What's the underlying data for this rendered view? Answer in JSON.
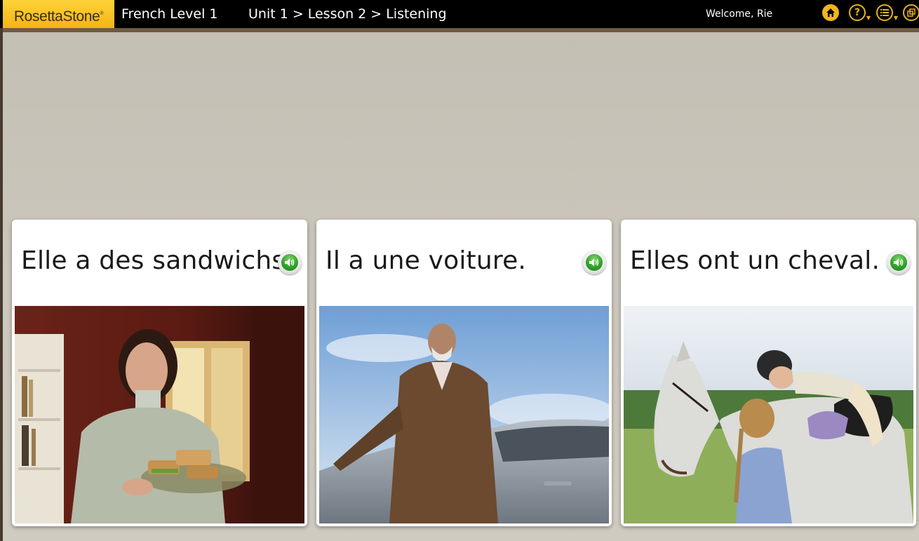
{
  "header": {
    "logo": "RosettaStone",
    "course_title": "French Level 1",
    "breadcrumb": [
      "Unit 1",
      "Lesson 2",
      "Listening"
    ],
    "breadcrumb_separator": ">",
    "welcome": "Welcome, Rie",
    "nav_icons": [
      "home-icon",
      "help-icon",
      "menu-list-icon",
      "window-icon"
    ]
  },
  "cards": [
    {
      "text": "Elle a des sandwichs.",
      "image": "woman-holding-sandwiches",
      "audio_icon": "speaker-icon"
    },
    {
      "text": "Il a une voiture.",
      "image": "man-standing-by-car",
      "audio_icon": "speaker-icon"
    },
    {
      "text": "Elles ont un cheval.",
      "image": "girls-with-horse",
      "audio_icon": "speaker-icon"
    }
  ],
  "colors": {
    "logo_bg": "#f3b416",
    "topbar_bg": "#000000",
    "stage_bg": "#c9c4b9",
    "accent_gold": "#e8b21c",
    "audio_green": "#2fa32a"
  }
}
